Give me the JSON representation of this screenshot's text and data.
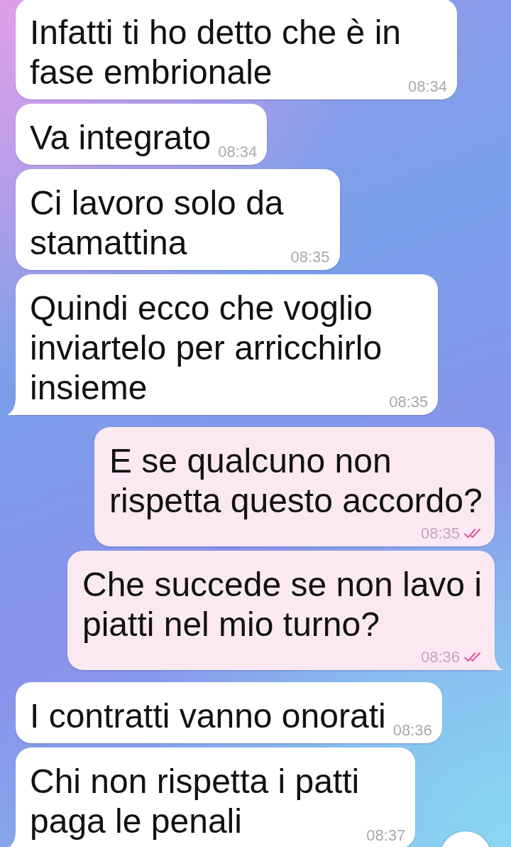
{
  "messages": [
    {
      "kind": "incoming",
      "text": "Infatti ti ho detto che è in\nfase embrionale",
      "time": "08:34"
    },
    {
      "kind": "incoming",
      "text": "Va integrato",
      "time": "08:34"
    },
    {
      "kind": "incoming",
      "text": "Ci lavoro solo da\nstamattina",
      "time": "08:35"
    },
    {
      "kind": "incoming",
      "text": "Quindi ecco che voglio\ninviartelo per arricchirlo\ninsieme",
      "time": "08:35"
    },
    {
      "kind": "outgoing",
      "text": "E se qualcuno non\nrispetta questo accordo?",
      "time": "08:35",
      "read": true
    },
    {
      "kind": "outgoing",
      "text": "Che succede se non lavo i\npiatti nel mio turno?",
      "time": "08:36",
      "read": true
    },
    {
      "kind": "incoming",
      "text": "I contratti vanno onorati",
      "time": "08:36"
    },
    {
      "kind": "incoming",
      "text": "Chi non rispetta i patti\npaga le penali",
      "time": "08:37"
    }
  ],
  "floating_button": true
}
